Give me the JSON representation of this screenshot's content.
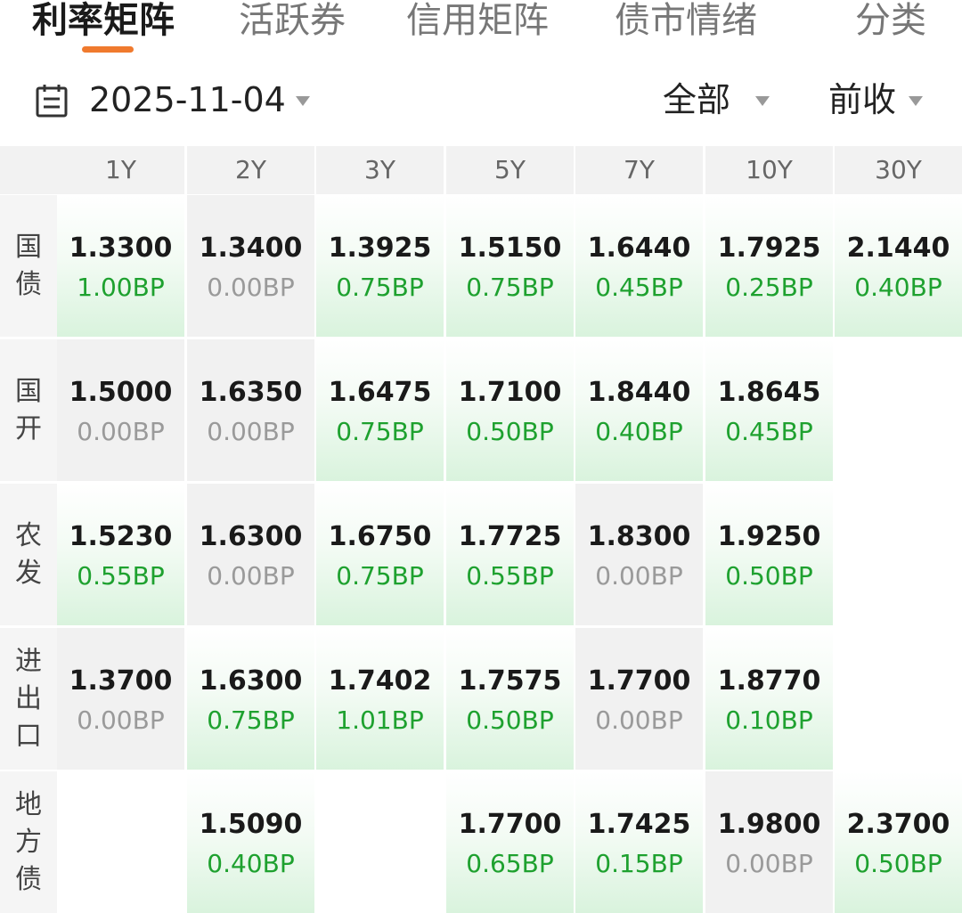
{
  "tabs": [
    {
      "label": "利率矩阵",
      "active": true
    },
    {
      "label": "活跃券",
      "active": false
    },
    {
      "label": "信用矩阵",
      "active": false
    },
    {
      "label": "债市情绪",
      "active": false
    },
    {
      "label": "分类",
      "active": false
    }
  ],
  "toolbar": {
    "date": "2025-11-04",
    "scope_filter": "全部",
    "price_filter": "前收",
    "icon": "calendar-icon"
  },
  "colors": {
    "accent": "#f07a2e",
    "change_up": "#1ea12f",
    "change_flat": "#9a9a9a"
  },
  "matrix": {
    "columns": [
      "1Y",
      "2Y",
      "3Y",
      "5Y",
      "7Y",
      "10Y",
      "30Y"
    ],
    "rows": [
      {
        "label": "国债",
        "cells": [
          {
            "rate": "1.3300",
            "bp": "1.00BP",
            "trend": "up"
          },
          {
            "rate": "1.3400",
            "bp": "0.00BP",
            "trend": "flat"
          },
          {
            "rate": "1.3925",
            "bp": "0.75BP",
            "trend": "up"
          },
          {
            "rate": "1.5150",
            "bp": "0.75BP",
            "trend": "up"
          },
          {
            "rate": "1.6440",
            "bp": "0.45BP",
            "trend": "up"
          },
          {
            "rate": "1.7925",
            "bp": "0.25BP",
            "trend": "up"
          },
          {
            "rate": "2.1440",
            "bp": "0.40BP",
            "trend": "up"
          }
        ]
      },
      {
        "label": "国开",
        "cells": [
          {
            "rate": "1.5000",
            "bp": "0.00BP",
            "trend": "flat"
          },
          {
            "rate": "1.6350",
            "bp": "0.00BP",
            "trend": "flat"
          },
          {
            "rate": "1.6475",
            "bp": "0.75BP",
            "trend": "up"
          },
          {
            "rate": "1.7100",
            "bp": "0.50BP",
            "trend": "up"
          },
          {
            "rate": "1.8440",
            "bp": "0.40BP",
            "trend": "up"
          },
          {
            "rate": "1.8645",
            "bp": "0.45BP",
            "trend": "up"
          },
          null
        ]
      },
      {
        "label": "农发",
        "cells": [
          {
            "rate": "1.5230",
            "bp": "0.55BP",
            "trend": "up"
          },
          {
            "rate": "1.6300",
            "bp": "0.00BP",
            "trend": "flat"
          },
          {
            "rate": "1.6750",
            "bp": "0.75BP",
            "trend": "up"
          },
          {
            "rate": "1.7725",
            "bp": "0.55BP",
            "trend": "up"
          },
          {
            "rate": "1.8300",
            "bp": "0.00BP",
            "trend": "flat"
          },
          {
            "rate": "1.9250",
            "bp": "0.50BP",
            "trend": "up"
          },
          null
        ]
      },
      {
        "label": "进出口",
        "cells": [
          {
            "rate": "1.3700",
            "bp": "0.00BP",
            "trend": "flat"
          },
          {
            "rate": "1.6300",
            "bp": "0.75BP",
            "trend": "up"
          },
          {
            "rate": "1.7402",
            "bp": "1.01BP",
            "trend": "up"
          },
          {
            "rate": "1.7575",
            "bp": "0.50BP",
            "trend": "up"
          },
          {
            "rate": "1.7700",
            "bp": "0.00BP",
            "trend": "flat"
          },
          {
            "rate": "1.8770",
            "bp": "0.10BP",
            "trend": "up"
          },
          null
        ]
      },
      {
        "label": "地方债",
        "cells": [
          null,
          {
            "rate": "1.5090",
            "bp": "0.40BP",
            "trend": "up"
          },
          null,
          {
            "rate": "1.7700",
            "bp": "0.65BP",
            "trend": "up"
          },
          {
            "rate": "1.7425",
            "bp": "0.15BP",
            "trend": "up"
          },
          {
            "rate": "1.9800",
            "bp": "0.00BP",
            "trend": "flat"
          },
          {
            "rate": "2.3700",
            "bp": "0.50BP",
            "trend": "up"
          }
        ]
      }
    ]
  }
}
